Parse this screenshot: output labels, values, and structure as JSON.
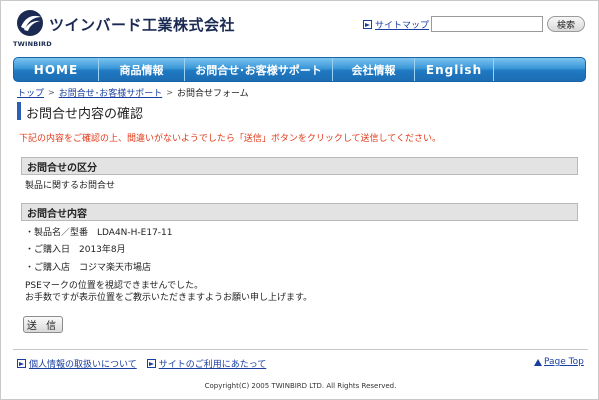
{
  "header": {
    "logo_text": "ツインバード工業株式会社",
    "logo_sub": "TWINBIRD",
    "sitemap_label": "サイトマップ",
    "search_placeholder": "",
    "search_button": "検索"
  },
  "nav": {
    "items": [
      "HOME",
      "商品情報",
      "お問合せ･お客様サポート",
      "会社情報",
      "English"
    ]
  },
  "breadcrumb": {
    "top": "トップ",
    "support": "お問合せ･お客様サポート",
    "current": "お問合せフォーム",
    "separator": ">"
  },
  "page": {
    "title": "お問合せ内容の確認",
    "notice": "下記の内容をご確認の上、間違いがないようでしたら「送信」ボタンをクリックして送信してください。"
  },
  "sections": {
    "category_heading": "お問合せの区分",
    "category_value": "製品に関するお問合せ",
    "content_heading": "お問合せ内容",
    "content_lines": [
      "・製品名／型番　LDA4N-H-E17-11",
      "・ご購入日　2013年8月",
      "・ご購入店　コジマ楽天市場店",
      "PSEマークの位置を視認できませんでした。",
      "お手数ですが表示位置をご教示いただきますようお願い申し上げます。"
    ]
  },
  "submit_label": "送 信",
  "footer": {
    "privacy": "個人情報の取扱いについて",
    "terms": "サイトのご利用にあたって",
    "page_top": "Page Top",
    "copyright": "Copyright(C) 2005 TWINBIRD LTD. All Rights Reserved."
  },
  "colors": {
    "accent": "#1c6db3",
    "link": "#1a3fa0",
    "notice": "#e23a1a",
    "section_bg": "#e3e3e3"
  },
  "icons": [
    "twinbird-logo-icon",
    "arrow-link-icon",
    "page-top-triangle-icon"
  ]
}
